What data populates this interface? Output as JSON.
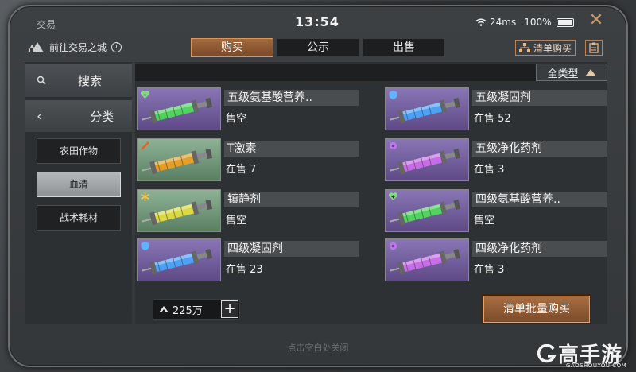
{
  "header": {
    "title": "交易",
    "clock": "13:54",
    "latency": "24ms",
    "battery": "100%"
  },
  "nav": {
    "goto_city": "前往交易之城",
    "tabs": [
      {
        "label": "购买",
        "active": true
      },
      {
        "label": "公示",
        "active": false
      },
      {
        "label": "出售",
        "active": false
      }
    ],
    "list_buy": "清单购买"
  },
  "sidebar": {
    "search": "搜索",
    "category": "分类",
    "items": [
      {
        "label": "农田作物",
        "active": false
      },
      {
        "label": "血清",
        "active": true
      },
      {
        "label": "战术耗材",
        "active": false
      }
    ]
  },
  "filter": {
    "label": "全类型"
  },
  "items": [
    {
      "name": "五级氨基酸营养..",
      "stock": "售空",
      "bg": "purple",
      "liquid": "#4fe05a",
      "badge": "heart-icon"
    },
    {
      "name": "五级凝固剂",
      "stock": "在售 52",
      "bg": "purple",
      "liquid": "#4aa8ff",
      "badge": "shield-icon"
    },
    {
      "name": "T激素",
      "stock": "在售 7",
      "bg": "green",
      "liquid": "#f0a020",
      "badge": "syringe-icon"
    },
    {
      "name": "五级净化药剂",
      "stock": "在售 3",
      "bg": "purple",
      "liquid": "#d070f0",
      "badge": "gear-icon"
    },
    {
      "name": "镇静剂",
      "stock": "售空",
      "bg": "green",
      "liquid": "#e8e040",
      "badge": "snowflake-icon"
    },
    {
      "name": "四级氨基酸营养..",
      "stock": "售空",
      "bg": "purple",
      "liquid": "#4fe05a",
      "badge": "heart-icon"
    },
    {
      "name": "四级凝固剂",
      "stock": "在售 23",
      "bg": "purple",
      "liquid": "#4aa8ff",
      "badge": "shield-icon"
    },
    {
      "name": "四级净化药剂",
      "stock": "在售 3",
      "bg": "purple",
      "liquid": "#d070f0",
      "badge": "gear-icon"
    }
  ],
  "footer": {
    "money": "225万",
    "bulk_buy": "清单批量购买",
    "tap_close": "点击空白处关闭"
  },
  "watermark": {
    "brand": "高手游",
    "domain": "GAOSHOUYOU.COM"
  }
}
